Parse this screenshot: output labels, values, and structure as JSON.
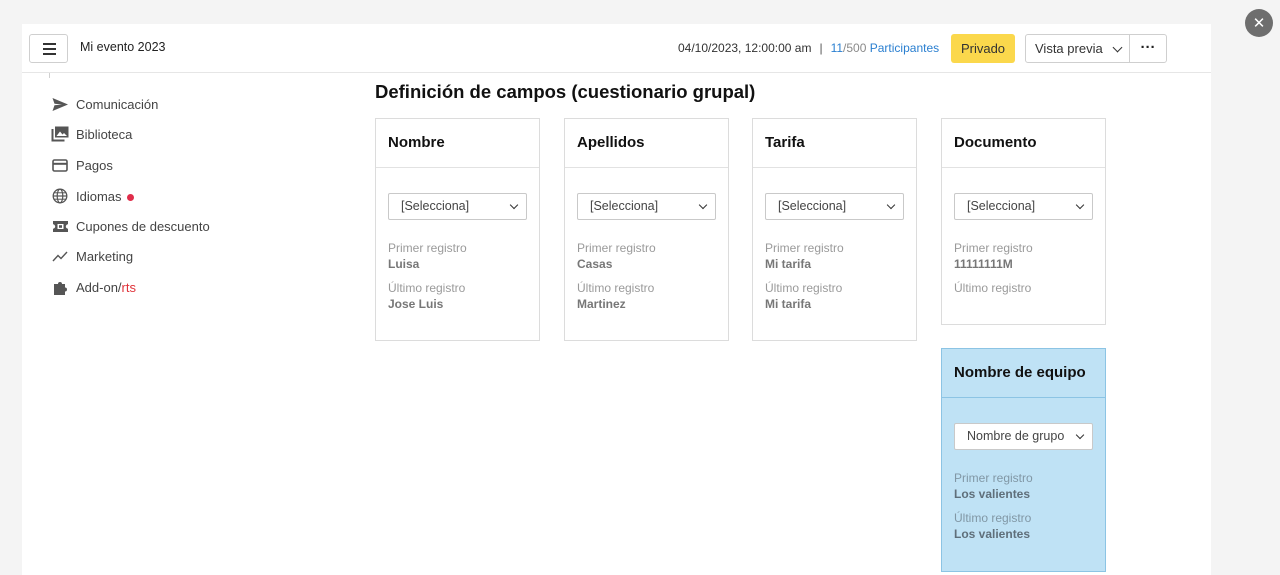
{
  "header": {
    "event_title": "Mi evento 2023",
    "datetime": "04/10/2023, 12:00:00 am",
    "separator": "|",
    "participants_count": "11",
    "participants_total": "/500",
    "participants_label": "Participantes",
    "privado_label": "Privado",
    "preview_label": "Vista previa",
    "more_label": "···"
  },
  "sidebar": {
    "items": [
      {
        "label": "Comunicación",
        "icon": "send-icon"
      },
      {
        "label": "Biblioteca",
        "icon": "photo-library-icon"
      },
      {
        "label": "Pagos",
        "icon": "credit-card-icon"
      },
      {
        "label": "Idiomas",
        "icon": "globe-icon"
      },
      {
        "label": "Cupones de descuento",
        "icon": "ticket-icon"
      },
      {
        "label": "Marketing",
        "icon": "trend-line-icon"
      },
      {
        "label_main": "Add-on/",
        "label_accent": "rts",
        "icon": "puzzle-icon"
      }
    ]
  },
  "main": {
    "title": "Definición de campos (cuestionario grupal)",
    "first_label": "Primer registro",
    "last_label": "Último registro",
    "cards": [
      {
        "title": "Nombre",
        "select": "[Selecciona]",
        "first": "Luisa",
        "last": "Jose Luis"
      },
      {
        "title": "Apellidos",
        "select": "[Selecciona]",
        "first": "Casas",
        "last": "Martinez"
      },
      {
        "title": "Tarifa",
        "select": "[Selecciona]",
        "first": "Mi tarifa",
        "last": "Mi tarifa"
      },
      {
        "title": "Documento",
        "select": "[Selecciona]",
        "first": "11111111M",
        "last": ""
      },
      {
        "title": "Nombre de equipo",
        "select": "Nombre de grupo",
        "first": "Los valientes",
        "last": "Los valientes"
      }
    ]
  },
  "colors": {
    "privado_bg": "#fbd84c",
    "link_blue": "#2a7fd0",
    "team_card_bg": "#bfe2f5",
    "alert_red": "#e02d4a"
  }
}
